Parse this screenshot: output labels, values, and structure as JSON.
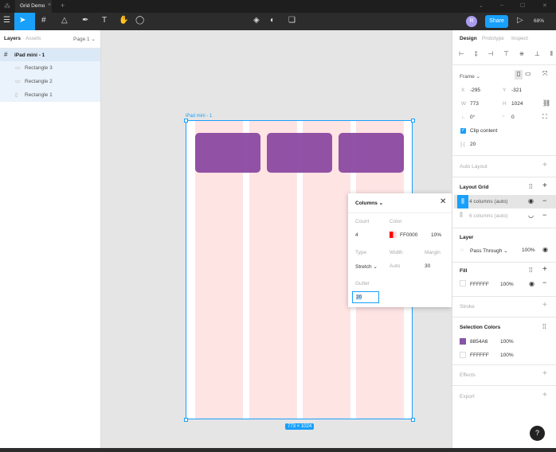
{
  "titlebar": {
    "tab": "Grid Demo",
    "close": "×",
    "new_tab": "+",
    "window_controls": [
      "⌄",
      "–",
      "☐",
      "✕"
    ]
  },
  "toolbar": {
    "zoom": "68%",
    "share": "Share",
    "avatar": "R",
    "play": "▷"
  },
  "left": {
    "tabs": [
      "Layers",
      "Assets"
    ],
    "page": "Page 1 ⌄",
    "layers": [
      {
        "name": "iPad mini - 1",
        "icon": "frame-icon"
      },
      {
        "name": "Rectangle 3"
      },
      {
        "name": "Rectangle 2"
      },
      {
        "name": "Rectangle 1"
      }
    ]
  },
  "canvas": {
    "frame_label": "iPad mini - 1",
    "size_badge": "773 × 1024",
    "grid_color": "#FF0000",
    "rect_color": "#8854A6"
  },
  "popup": {
    "title": "Columns ⌄",
    "count_label": "Count",
    "count": "4",
    "color_label": "Color",
    "color_hex": "FF0000",
    "color_opacity": "10%",
    "type_label": "Type",
    "type": "Stretch ⌄",
    "width_label": "Width",
    "width": "Auto",
    "margin_label": "Margin",
    "margin": "30",
    "gutter_label": "Gutter",
    "gutter": "20"
  },
  "right": {
    "tabs": [
      "Design",
      "Prototype",
      "Inspect"
    ],
    "frame": "Frame ⌄",
    "x_label": "X",
    "x": "-295",
    "y_label": "Y",
    "y": "-321",
    "w_label": "W",
    "w": "773",
    "h_label": "H",
    "h": "1024",
    "rotation": "0°",
    "radius": "0",
    "clip": "Clip content",
    "spacing": "20",
    "auto_layout": "Auto Layout",
    "layout_grid": "Layout Grid",
    "grids": [
      "4 columns (auto)",
      "6 columns (auto)"
    ],
    "layer": "Layer",
    "blend": "Pass Through ⌄",
    "layer_opacity": "100%",
    "fill": "Fill",
    "fill_hex": "FFFFFF",
    "fill_opacity": "100%",
    "stroke": "Stroke",
    "selection_colors": "Selection Colors",
    "sel": [
      {
        "hex": "8854A6",
        "opacity": "100%",
        "color": "#8854A6"
      },
      {
        "hex": "FFFFFF",
        "opacity": "100%",
        "color": "#FFFFFF"
      }
    ],
    "effects": "Effects",
    "export": "Export",
    "help": "?"
  }
}
